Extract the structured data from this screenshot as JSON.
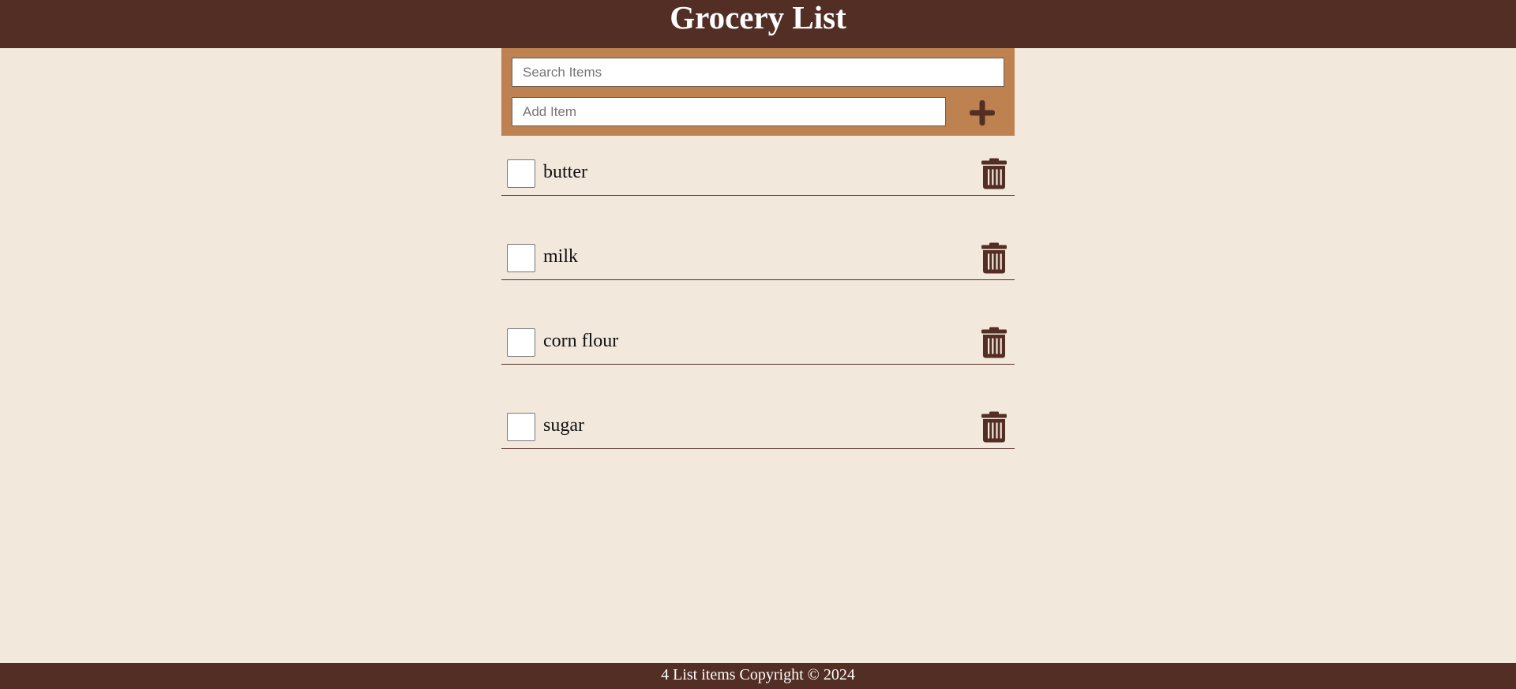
{
  "header": {
    "title": "Grocery List"
  },
  "controls": {
    "search_placeholder": "Search Items",
    "add_placeholder": "Add Item",
    "add_icon": "plus-icon"
  },
  "items": [
    {
      "label": "butter",
      "checked": false,
      "delete_icon": "trash-icon"
    },
    {
      "label": "milk",
      "checked": false,
      "delete_icon": "trash-icon"
    },
    {
      "label": "corn flour",
      "checked": false,
      "delete_icon": "trash-icon"
    },
    {
      "label": "sugar",
      "checked": false,
      "delete_icon": "trash-icon"
    }
  ],
  "footer": {
    "text": "4 List items Copyright © 2024"
  },
  "colors": {
    "header_bg": "#532e24",
    "controls_bg": "#be8250",
    "page_bg": "#f3e8dc",
    "icon": "#532e24"
  }
}
